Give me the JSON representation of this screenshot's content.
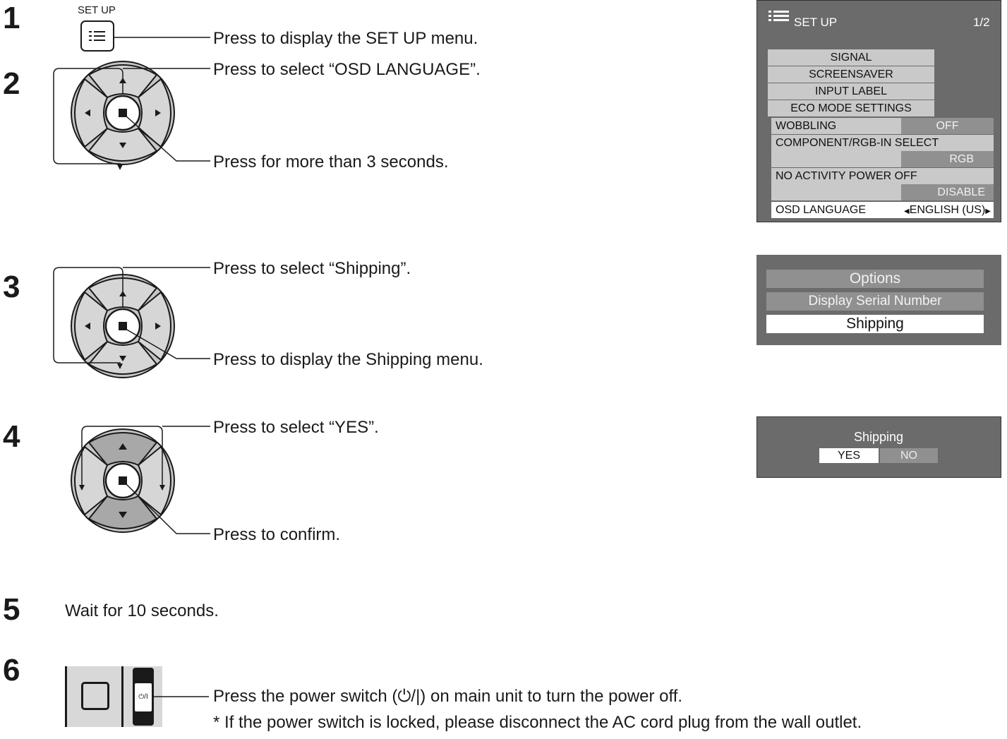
{
  "steps": [
    {
      "number": "1",
      "button_label": "SET UP",
      "instruction": "Press to display the SET UP menu."
    },
    {
      "number": "2",
      "instruction_top": "Press to select “OSD LANGUAGE”.",
      "instruction_bottom": "Press for more than 3 seconds."
    },
    {
      "number": "3",
      "instruction_top": "Press to select “Shipping”.",
      "instruction_bottom": "Press to display the Shipping menu."
    },
    {
      "number": "4",
      "instruction_top": "Press to select “YES”.",
      "instruction_bottom": "Press to confirm."
    },
    {
      "number": "5",
      "instruction": "Wait for 10 seconds."
    },
    {
      "number": "6",
      "switch_label": "⏻/I",
      "instruction": "Press the power switch (⏻/|) on main unit to turn the power off.",
      "note": "* If the power switch is locked, please disconnect the AC cord plug from the wall outlet."
    }
  ],
  "setup_menu": {
    "title": "SET UP",
    "page": "1/2",
    "items": [
      "SIGNAL",
      "SCREENSAVER",
      "INPUT LABEL",
      "ECO MODE SETTINGS"
    ],
    "wobbling": {
      "label": "WOBBLING",
      "value": "OFF"
    },
    "component": {
      "label": "COMPONENT/RGB-IN SELECT",
      "value": "RGB"
    },
    "no_activity": {
      "label": "NO ACTIVITY POWER OFF",
      "value": "DISABLE"
    },
    "osd_language": {
      "label": "OSD LANGUAGE",
      "value": "ENGLISH (US)"
    }
  },
  "options_menu": {
    "items": [
      "Options",
      "Display Serial Number",
      "Shipping"
    ]
  },
  "shipping_dialog": {
    "title": "Shipping",
    "yes": "YES",
    "no": "NO"
  },
  "colors": {
    "osd_background": "#6b6b6b",
    "osd_light": "#c9c9c9",
    "osd_dark": "#909090",
    "highlight": "#ffffff"
  }
}
